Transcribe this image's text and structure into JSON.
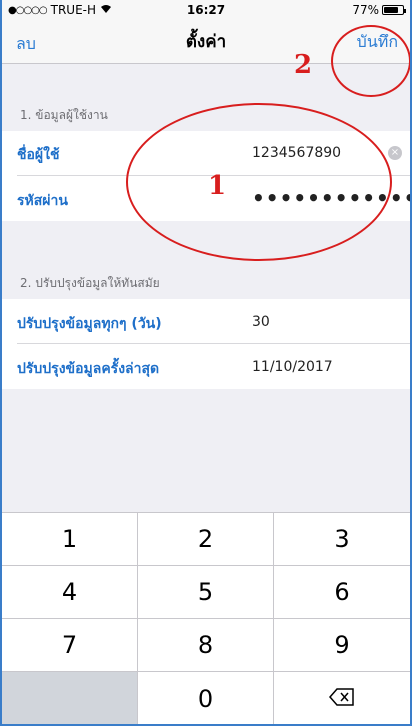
{
  "status_bar": {
    "carrier": "TRUE-H",
    "signal_dots": "●○○○○",
    "time": "16:27",
    "battery": "77%",
    "battery_level": 0.77
  },
  "nav": {
    "left": "ลบ",
    "title": "ตั้งค่า",
    "right": "บันทึก"
  },
  "sections": [
    {
      "header": "1. ข้อมูลผู้ใช้งาน",
      "rows": [
        {
          "label": "ชื่อผู้ใช้",
          "value": "1234567890"
        },
        {
          "label": "รหัสผ่าน",
          "value": "•••••••••••••"
        }
      ]
    },
    {
      "header": "2. ปรับปรุงข้อมูลให้ทันสมัย",
      "rows": [
        {
          "label": "ปรับปรุงข้อมูลทุกๆ (วัน)",
          "value": "30"
        },
        {
          "label": "ปรับปรุงข้อมูลครั้งล่าสุด",
          "value": "11/10/2017"
        }
      ]
    }
  ],
  "annotations": {
    "one": "1",
    "two": "2"
  },
  "keypad": {
    "keys": [
      "1",
      "2",
      "3",
      "4",
      "5",
      "6",
      "7",
      "8",
      "9",
      "",
      "0",
      "⌫"
    ]
  },
  "colors": {
    "accent": "#2b7cd3",
    "annotation": "#d81e1e"
  }
}
